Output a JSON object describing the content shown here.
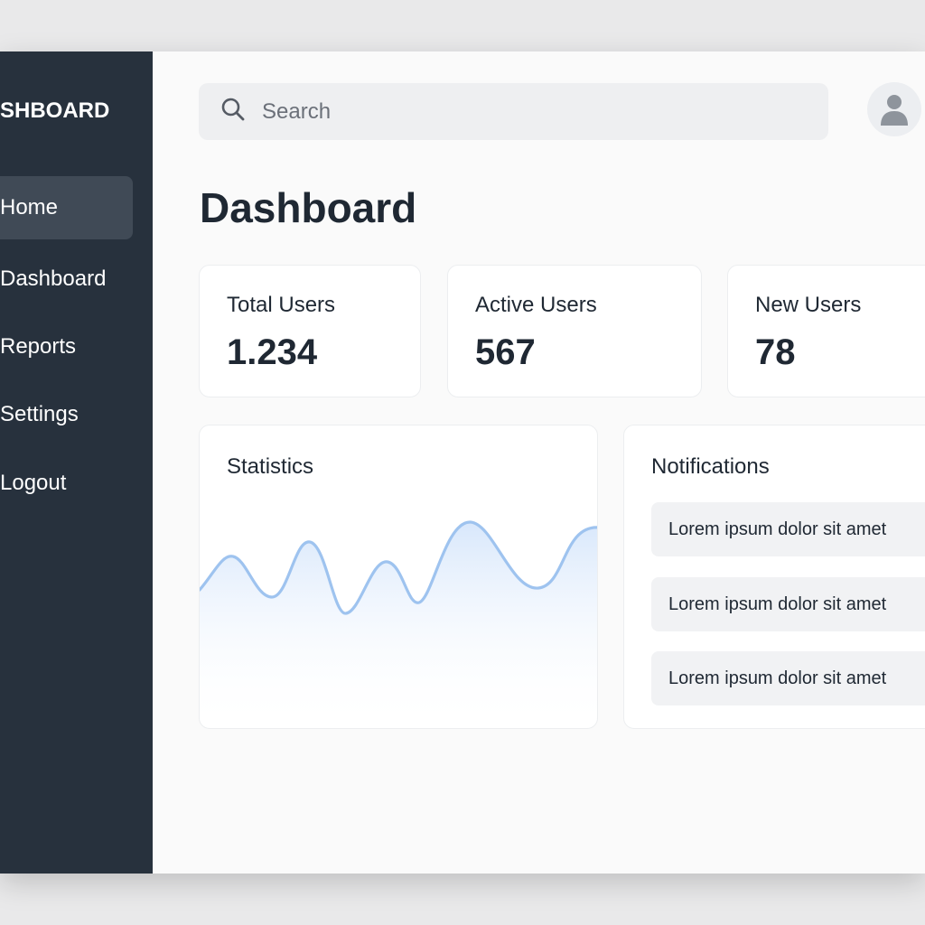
{
  "sidebar": {
    "brand": "SHBOARD",
    "items": [
      {
        "label": "Home",
        "active": true
      },
      {
        "label": "Dashboard"
      },
      {
        "label": "Reports"
      },
      {
        "label": "Settings"
      },
      {
        "label": "Logout"
      }
    ]
  },
  "header": {
    "search_placeholder": "Search",
    "search_icon": "search-icon",
    "avatar_icon": "user-icon"
  },
  "main": {
    "title": "Dashboard",
    "stats": [
      {
        "label": "Total Users",
        "value": "1.234"
      },
      {
        "label": "Active Users",
        "value": "567"
      },
      {
        "label": "New Users",
        "value": "78"
      }
    ],
    "statistics": {
      "title": "Statistics"
    },
    "notifications": {
      "title": "Notifications",
      "items": [
        "Lorem ipsum dolor sit amet",
        "Lorem ipsum dolor sit amet",
        "Lorem ipsum dolor sit amet"
      ]
    }
  },
  "colors": {
    "sidebar": "#27313d",
    "sidebar_active": "#404a56",
    "chart_line": "#9ec3ef",
    "text": "#1f2833"
  }
}
